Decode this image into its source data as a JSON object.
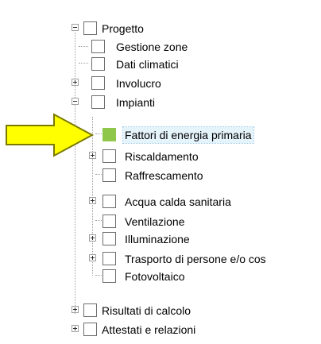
{
  "tree": {
    "items": [
      {
        "label": "Progetto",
        "expander": "minus",
        "checkbox": "empty"
      },
      {
        "label": "Gestione zone",
        "expander": "none",
        "checkbox": "empty"
      },
      {
        "label": "Dati climatici",
        "expander": "none",
        "checkbox": "empty"
      },
      {
        "label": "Involucro",
        "expander": "plus",
        "checkbox": "empty"
      },
      {
        "label": "Impianti",
        "expander": "minus",
        "checkbox": "empty"
      },
      {
        "label": "Fattori di energia primaria",
        "expander": "none",
        "checkbox": "filled",
        "selected": true
      },
      {
        "label": "Riscaldamento",
        "expander": "plus",
        "checkbox": "empty"
      },
      {
        "label": "Raffrescamento",
        "expander": "none",
        "checkbox": "empty"
      },
      {
        "label": "Acqua calda sanitaria",
        "expander": "plus",
        "checkbox": "empty"
      },
      {
        "label": "Ventilazione",
        "expander": "none",
        "checkbox": "empty"
      },
      {
        "label": "Illuminazione",
        "expander": "plus",
        "checkbox": "empty"
      },
      {
        "label": "Trasporto di persone e/o cos",
        "expander": "plus",
        "checkbox": "empty"
      },
      {
        "label": "Fotovoltaico",
        "expander": "none",
        "checkbox": "empty"
      },
      {
        "label": "Risultati di calcolo",
        "expander": "plus",
        "checkbox": "empty"
      },
      {
        "label": "Attestati e relazioni",
        "expander": "plus",
        "checkbox": "empty"
      }
    ]
  },
  "colors": {
    "checkbox_filled": "#8fc74a",
    "arrow_fill": "#ffff00",
    "arrow_stroke": "#7a7a00"
  },
  "annotation": {
    "icon": "arrow-right-icon"
  }
}
